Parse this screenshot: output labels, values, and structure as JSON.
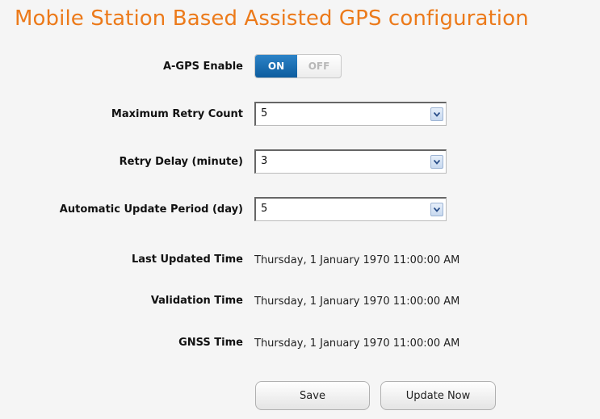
{
  "page": {
    "title": "Mobile Station Based Assisted GPS configuration"
  },
  "agps_enable": {
    "label": "A-GPS Enable",
    "on_label": "ON",
    "off_label": "OFF",
    "state": "on"
  },
  "max_retry": {
    "label": "Maximum Retry Count",
    "value": "5"
  },
  "retry_delay": {
    "label": "Retry Delay (minute)",
    "value": "3"
  },
  "update_period": {
    "label": "Automatic Update Period (day)",
    "value": "5"
  },
  "last_updated": {
    "label": "Last Updated Time",
    "value": "Thursday, 1 January 1970 11:00:00 AM"
  },
  "validation": {
    "label": "Validation Time",
    "value": "Thursday, 1 January 1970 11:00:00 AM"
  },
  "gnss": {
    "label": "GNSS Time",
    "value": "Thursday, 1 January 1970 11:00:00 AM"
  },
  "buttons": {
    "save": "Save",
    "update_now": "Update Now"
  },
  "colors": {
    "title": "#ec7a1a",
    "toggle_on": "#0d5c9e"
  },
  "icons": {
    "dropdown": "chevron-down-icon"
  }
}
